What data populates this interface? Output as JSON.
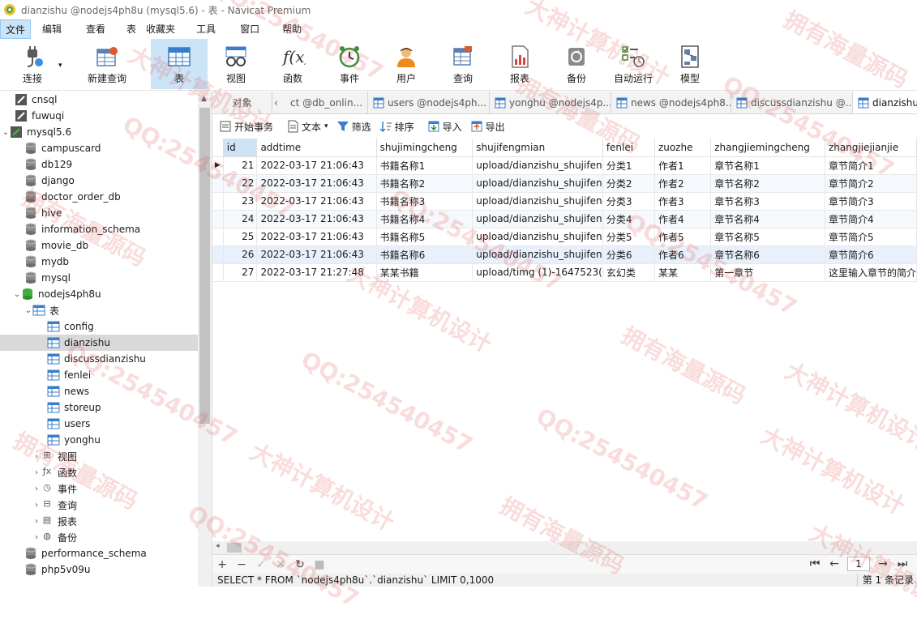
{
  "window_title": "dianzishu @nodejs4ph8u (mysql5.6) - 表 - Navicat Premium",
  "menu": [
    "文件",
    "编辑",
    "查看",
    "表",
    "收藏夹",
    "工具",
    "窗口",
    "帮助"
  ],
  "toolbar": {
    "connect": "连接",
    "new_query": "新建查询",
    "table": "表",
    "view": "视图",
    "function": "函数",
    "event": "事件",
    "user": "用户",
    "query": "查询",
    "report": "报表",
    "backup": "备份",
    "automation": "自动运行",
    "model": "模型"
  },
  "tree": {
    "connections": [
      "cnsql",
      "fuwuqi"
    ],
    "server": "mysql5.6",
    "databases_before": [
      "campuscard",
      "db129",
      "django",
      "doctor_order_db",
      "hive",
      "information_schema",
      "movie_db",
      "mydb",
      "mysql"
    ],
    "active_db": "nodejs4ph8u",
    "tables_folder": "表",
    "tables": [
      "config",
      "dianzishu",
      "discussdianzishu",
      "fenlei",
      "news",
      "storeup",
      "users",
      "yonghu"
    ],
    "groups": [
      "视图",
      "函数",
      "事件",
      "查询",
      "报表",
      "备份"
    ],
    "databases_after": [
      "performance_schema",
      "php5v09u"
    ]
  },
  "tabs": {
    "objects": "对象",
    "items": [
      "ct @db_onlin...",
      "users @nodejs4ph...",
      "yonghu @nodejs4p...",
      "news @nodejs4ph8...",
      "discussdianzishu @...",
      "dianzishu @"
    ]
  },
  "actions": {
    "begin_tx": "开始事务",
    "text": "文本",
    "filter": "筛选",
    "sort": "排序",
    "import": "导入",
    "export": "导出"
  },
  "grid": {
    "columns": [
      "id",
      "addtime",
      "shujimingcheng",
      "shujifengmian",
      "fenlei",
      "zuozhe",
      "zhangjiemingcheng",
      "zhangjiejianjie"
    ],
    "rows": [
      [
        "21",
        "2022-03-17 21:06:43",
        "书籍名称1",
        "upload/dianzishu_shujifen",
        "分类1",
        "作者1",
        "章节名称1",
        "章节简介1"
      ],
      [
        "22",
        "2022-03-17 21:06:43",
        "书籍名称2",
        "upload/dianzishu_shujifen",
        "分类2",
        "作者2",
        "章节名称2",
        "章节简介2"
      ],
      [
        "23",
        "2022-03-17 21:06:43",
        "书籍名称3",
        "upload/dianzishu_shujifen",
        "分类3",
        "作者3",
        "章节名称3",
        "章节简介3"
      ],
      [
        "24",
        "2022-03-17 21:06:43",
        "书籍名称4",
        "upload/dianzishu_shujifen",
        "分类4",
        "作者4",
        "章节名称4",
        "章节简介4"
      ],
      [
        "25",
        "2022-03-17 21:06:43",
        "书籍名称5",
        "upload/dianzishu_shujifen",
        "分类5",
        "作者5",
        "章节名称5",
        "章节简介5"
      ],
      [
        "26",
        "2022-03-17 21:06:43",
        "书籍名称6",
        "upload/dianzishu_shujifen",
        "分类6",
        "作者6",
        "章节名称6",
        "章节简介6"
      ],
      [
        "27",
        "2022-03-17 21:27:48",
        "某某书籍",
        "upload/timg (1)-1647523(",
        "玄幻类",
        "某某",
        "第一章节",
        "这里输入章节的简介"
      ]
    ]
  },
  "pager": {
    "page": "1"
  },
  "status": {
    "sql": "SELECT * FROM `nodejs4ph8u`.`dianzishu` LIMIT 0,1000",
    "record_count": "第 1 条记录"
  },
  "watermark": [
    "QQ:254540457",
    "大神计算机设计",
    "拥有海量源码"
  ]
}
